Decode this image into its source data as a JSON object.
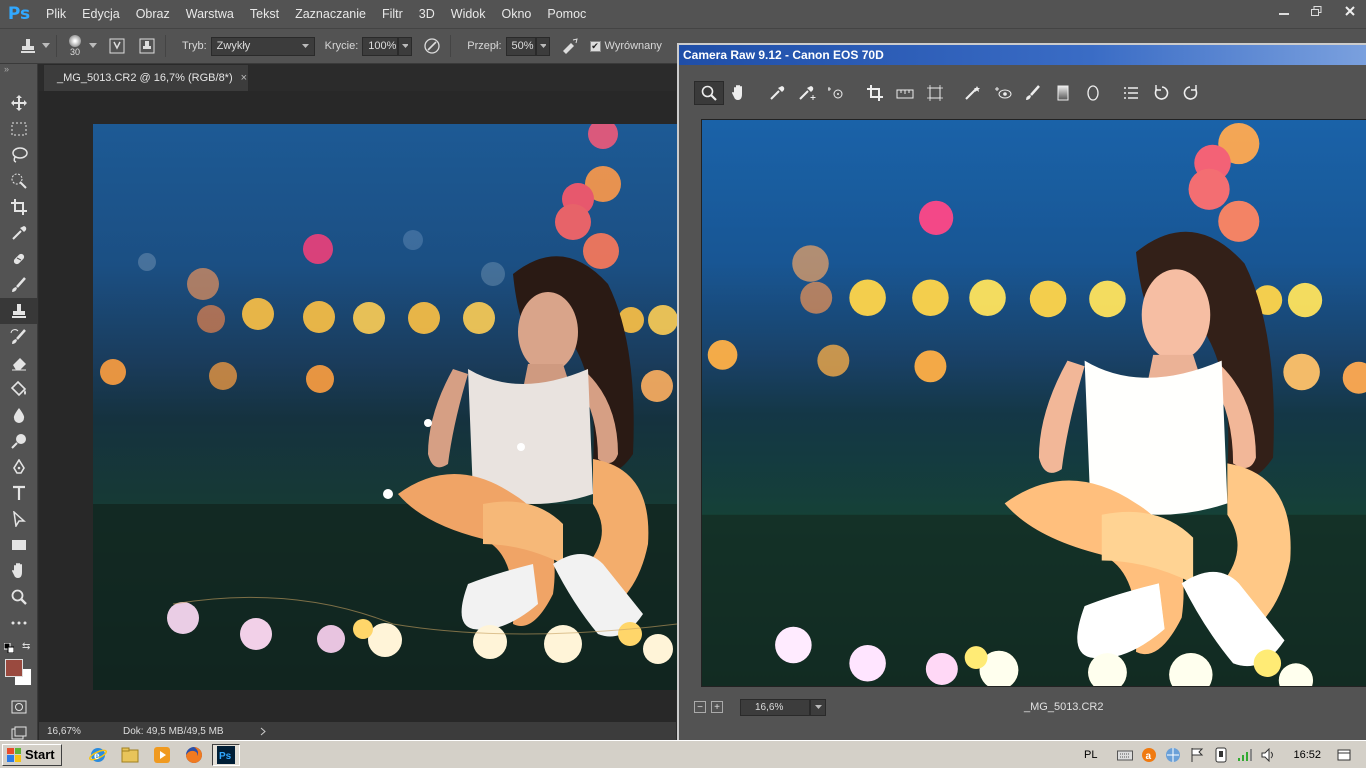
{
  "app": {
    "logo": "Ps",
    "menu": [
      "Plik",
      "Edycja",
      "Obraz",
      "Warstwa",
      "Tekst",
      "Zaznaczanie",
      "Filtr",
      "3D",
      "Widok",
      "Okno",
      "Pomoc"
    ]
  },
  "options": {
    "brush_size": "30",
    "mode_label": "Tryb:",
    "mode_value": "Zwykły",
    "opacity_label": "Krycie:",
    "opacity_value": "100%",
    "flow_label": "Przepł:",
    "flow_value": "50%",
    "aligned_label": "Wyrównany"
  },
  "document": {
    "tab_title": "_MG_5013.CR2 @ 16,7% (RGB/8*)",
    "close_glyph": "×",
    "zoom": "16,67%",
    "doc_info": "Dok: 49,5 MB/49,5 MB"
  },
  "camera_raw": {
    "title": "Camera Raw 9.12  -  Canon EOS 70D",
    "zoom": "16,6%",
    "filename": "_MG_5013.CR2"
  },
  "taskbar": {
    "start_label": "Start",
    "language": "PL",
    "clock": "16:52"
  },
  "colors": {
    "foreground": "#9a4a3f",
    "background": "#ffffff",
    "accent": "#31a8ff"
  }
}
